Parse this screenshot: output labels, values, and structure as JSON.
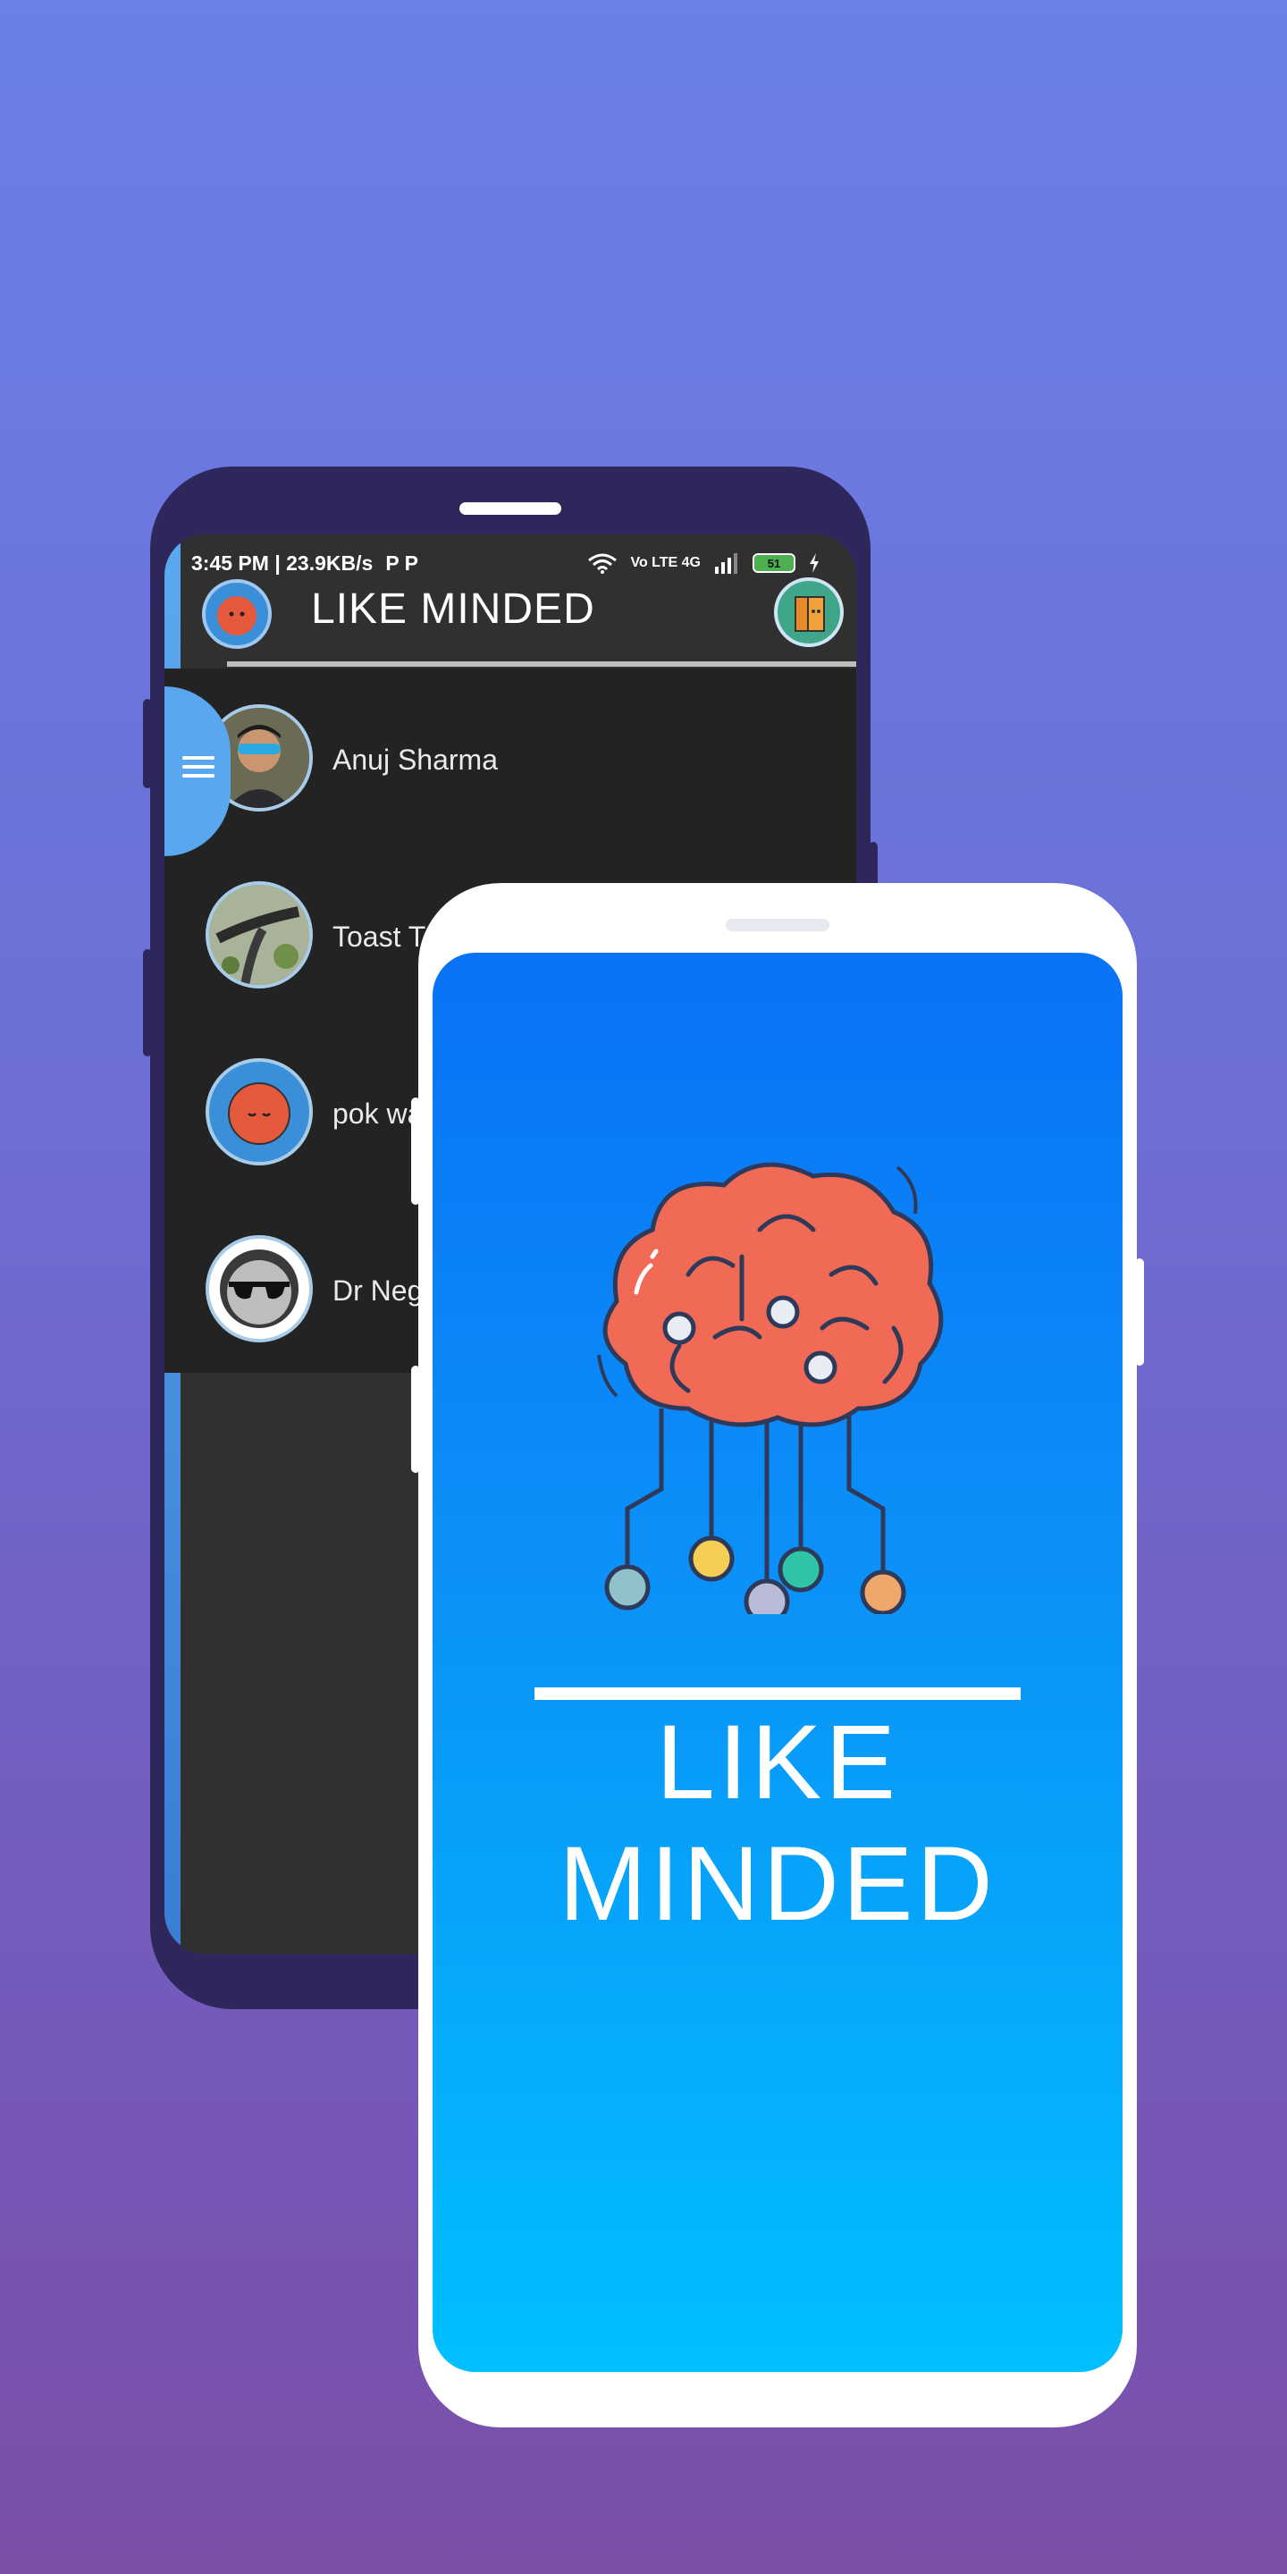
{
  "back_screen": {
    "status": {
      "time_speed": "3:45 PM | 23.9KB/s",
      "carrier_icons": "P P",
      "network": "Vo LTE 4G",
      "battery": "51"
    },
    "appbar": {
      "title": "LIKE MINDED"
    },
    "contacts": [
      {
        "name": "Anuj Sharma"
      },
      {
        "name": "Toast T"
      },
      {
        "name": "pok wa"
      },
      {
        "name": "Dr Neg"
      }
    ]
  },
  "front_screen": {
    "logo_text": "LIKE MINDED"
  },
  "colors": {
    "background_top": "#6a7fe8",
    "background_bottom": "#7a4fa8",
    "back_phone_frame": "#2e275c",
    "brain": "#f06a55",
    "screen_gradient_top": "#0a72f6",
    "screen_gradient_bottom": "#00bfff"
  }
}
